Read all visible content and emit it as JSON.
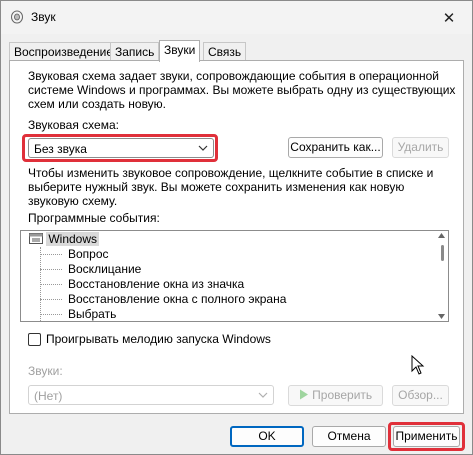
{
  "window": {
    "title": "Звук",
    "close_glyph": "✕"
  },
  "tabs": [
    {
      "label": "Воспроизведение",
      "active": false
    },
    {
      "label": "Запись",
      "active": false
    },
    {
      "label": "Звуки",
      "active": true
    },
    {
      "label": "Связь",
      "active": false
    }
  ],
  "sounds_tab": {
    "scheme_description": [
      "Звуковая схема задает звуки, сопровождающие события в операционной",
      "системе Windows и программах. Вы можете выбрать одну из существующих",
      "схем или создать новую."
    ],
    "scheme_label": "Звуковая схема:",
    "scheme_value": "Без звука",
    "save_as_button": "Сохранить как...",
    "delete_button": "Удалить",
    "events_description": [
      "Чтобы изменить звуковое сопровождение, щелкните событие в списке и",
      "выберите нужный звук. Вы можете сохранить изменения как новую",
      "звуковую схему."
    ],
    "events_label": "Программные события:",
    "events_tree": {
      "root": "Windows",
      "items": [
        "Вопрос",
        "Восклицание",
        "Восстановление окна из значка",
        "Восстановление окна с полного экрана",
        "Выбрать"
      ]
    },
    "startup_checkbox_label": "Проигрывать мелодию запуска Windows",
    "startup_checkbox_checked": false,
    "sounds_label": "Звуки:",
    "sounds_value": "(Нет)",
    "test_button": "Проверить",
    "browse_button": "Обзор..."
  },
  "footer": {
    "ok_button": "OK",
    "cancel_button": "Отмена",
    "apply_button": "Применить"
  },
  "colors": {
    "highlight": "#e0303a",
    "primary_border": "#0067c0",
    "play_green": "#9fd59f"
  },
  "icons": [
    "sound-app-icon",
    "close-icon",
    "chevron-down-icon",
    "folder-icon",
    "play-icon",
    "scroll-up-icon",
    "scroll-down-icon",
    "mouse-cursor-icon"
  ]
}
